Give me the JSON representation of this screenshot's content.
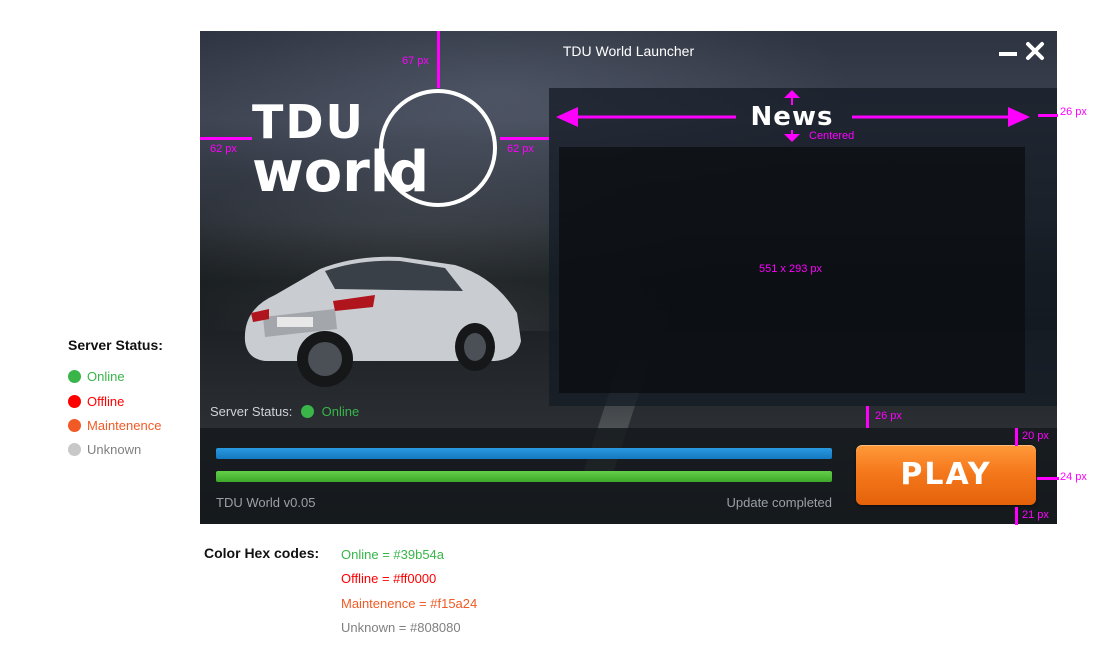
{
  "window": {
    "title": "TDU World Launcher",
    "minimize_icon": "minimize-icon",
    "close_icon": "close-icon"
  },
  "logo": {
    "line1": "TDU",
    "line2": "world"
  },
  "news": {
    "title": "News",
    "content_label": "551 x 293 px"
  },
  "server_status": {
    "label": "Server Status:",
    "value": "Online",
    "color": "#39b54a"
  },
  "footer": {
    "version": "TDU World v0.05",
    "update_status": "Update completed",
    "play_label": "PLAY",
    "download_progress": 1.0,
    "install_progress": 1.0
  },
  "annotations": {
    "top_margin": "67 px",
    "logo_left": "62 px",
    "logo_right": "62 px",
    "news_right": "26 px",
    "news_centered": "Centered",
    "news_bottom": "26 px",
    "play_top": "20 px",
    "play_right": "24 px",
    "play_bottom": "21 px"
  },
  "legend": {
    "title": "Server Status:",
    "items": [
      {
        "label": "Online",
        "color": "#39b54a"
      },
      {
        "label": "Offline",
        "color": "#ff0000"
      },
      {
        "label": "Maintenence",
        "color": "#f15a24"
      },
      {
        "label": "Unknown",
        "color": "#808080"
      }
    ]
  },
  "hex_codes": {
    "title": "Color Hex codes:",
    "items": [
      {
        "text": "Online = #39b54a",
        "color": "#39b54a"
      },
      {
        "text": "Offline = #ff0000",
        "color": "#ff0000"
      },
      {
        "text": "Maintenence = #f15a24",
        "color": "#f15a24"
      },
      {
        "text": "Unknown = #808080",
        "color": "#808080"
      }
    ]
  }
}
